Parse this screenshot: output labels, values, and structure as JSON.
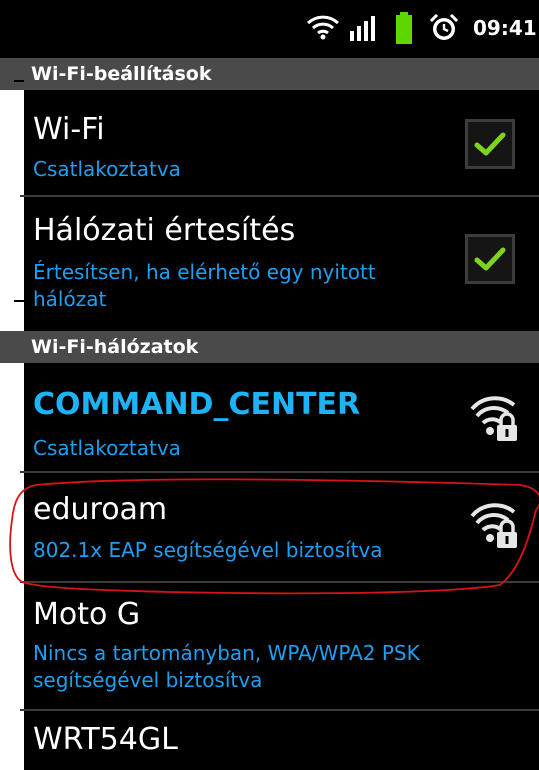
{
  "status_bar": {
    "time": "09:41",
    "icons": [
      "wifi-icon",
      "signal-icon",
      "battery-icon",
      "alarm-icon"
    ]
  },
  "wifi_settings": {
    "header": "Wi-Fi-beállítások",
    "wifi": {
      "title": "Wi-Fi",
      "status": "Csatlakoztatva",
      "checked": true
    },
    "network_notification": {
      "title": "Hálózati értesítés",
      "desc_line1": "Értesítsen, ha elérhető egy nyitott",
      "desc_line2": "hálózat",
      "checked": true
    }
  },
  "wifi_networks": {
    "header": "Wi-Fi-hálózatok",
    "networks": [
      {
        "name": "COMMAND_CENTER",
        "status": "Csatlakoztatva",
        "connected": true,
        "secured": true
      },
      {
        "name": "eduroam",
        "status": "802.1x EAP segítségével biztosítva",
        "secured": true
      },
      {
        "name": "Moto G",
        "status_line1": "Nincs a tartományban, WPA/WPA2 PSK",
        "status_line2": "segítségével biztosítva"
      },
      {
        "name": "WRT54GL"
      }
    ]
  },
  "colors": {
    "accent": "#1e9ff2",
    "header_bg": "#4a4a4a",
    "check_green": "#7ed321",
    "battery_green": "#5fd600",
    "annotation_red": "#d71414"
  }
}
